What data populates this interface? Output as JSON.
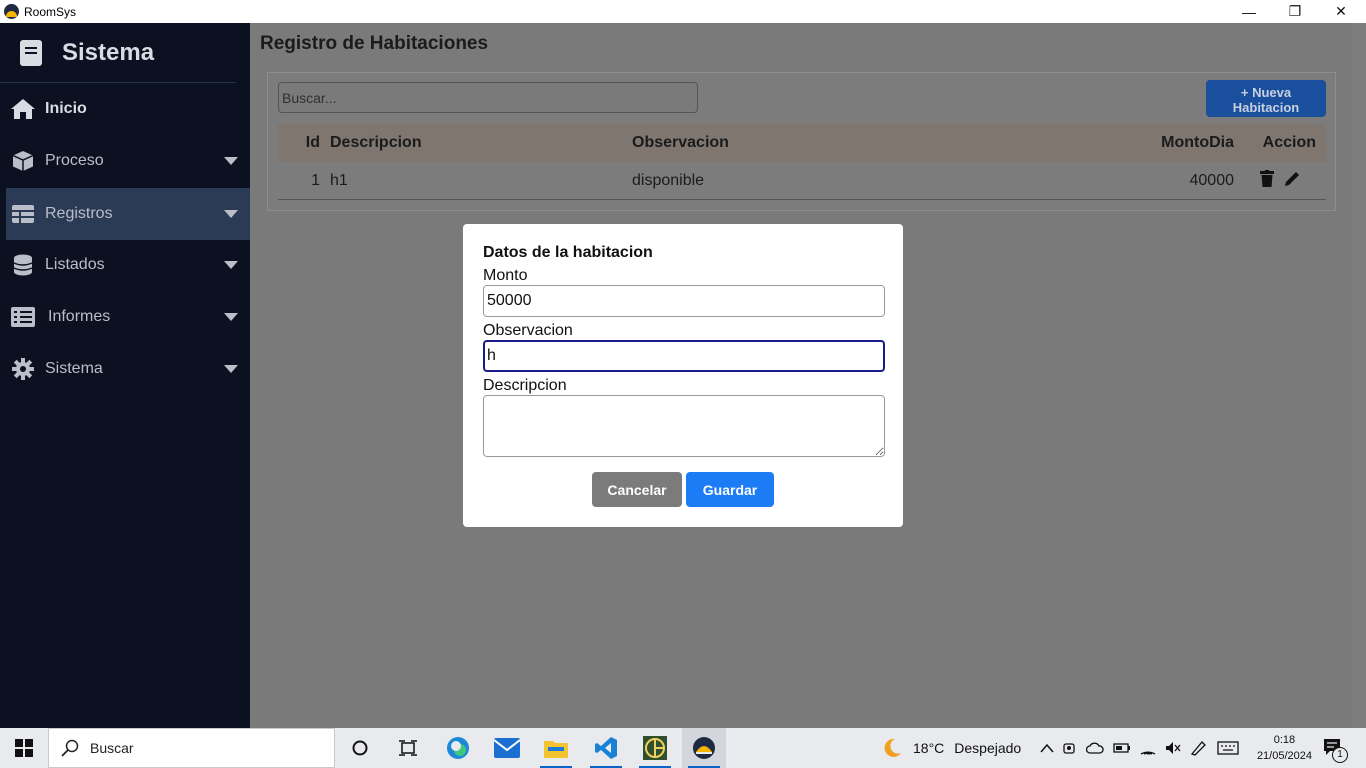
{
  "window": {
    "title": "RoomSys",
    "controls": [
      "—",
      "❐",
      "✕"
    ]
  },
  "sidebar": {
    "brand": "Sistema",
    "items": [
      {
        "label": "Inicio",
        "icon": "home-icon"
      },
      {
        "label": "Proceso",
        "icon": "box-icon"
      },
      {
        "label": "Registros",
        "icon": "table-icon"
      },
      {
        "label": "Listados",
        "icon": "database-icon"
      },
      {
        "label": "Informes",
        "icon": "list-icon"
      },
      {
        "label": "Sistema",
        "icon": "gear-icon"
      }
    ]
  },
  "page": {
    "title": "Registro de Habitaciones",
    "search_placeholder": "Buscar...",
    "new_button_label": "Nueva Habitacion",
    "new_button_icon": "+"
  },
  "table": {
    "headers": {
      "id": "Id",
      "desc": "Descripcion",
      "obs": "Observacion",
      "monto": "MontoDia",
      "accion": "Accion"
    },
    "rows": [
      {
        "id": "1",
        "desc": "h1",
        "obs": "disponible",
        "monto": "40000"
      }
    ]
  },
  "modal": {
    "title": "Datos de la habitacion",
    "monto_label": "Monto",
    "monto_value": "50000",
    "obs_label": "Observacion",
    "obs_value": "h",
    "desc_label": "Descripcion",
    "desc_value": "",
    "cancel_label": "Cancelar",
    "save_label": "Guardar"
  },
  "taskbar": {
    "search_label": "Buscar",
    "weather_temp": "18°C",
    "weather_desc": "Despejado",
    "time": "0:18",
    "date": "21/05/2024",
    "notification_count": "1"
  },
  "colors": {
    "sidebar_bg": "#0b1120",
    "primary": "#1b7cf5",
    "secondary": "#7b7b7b"
  }
}
